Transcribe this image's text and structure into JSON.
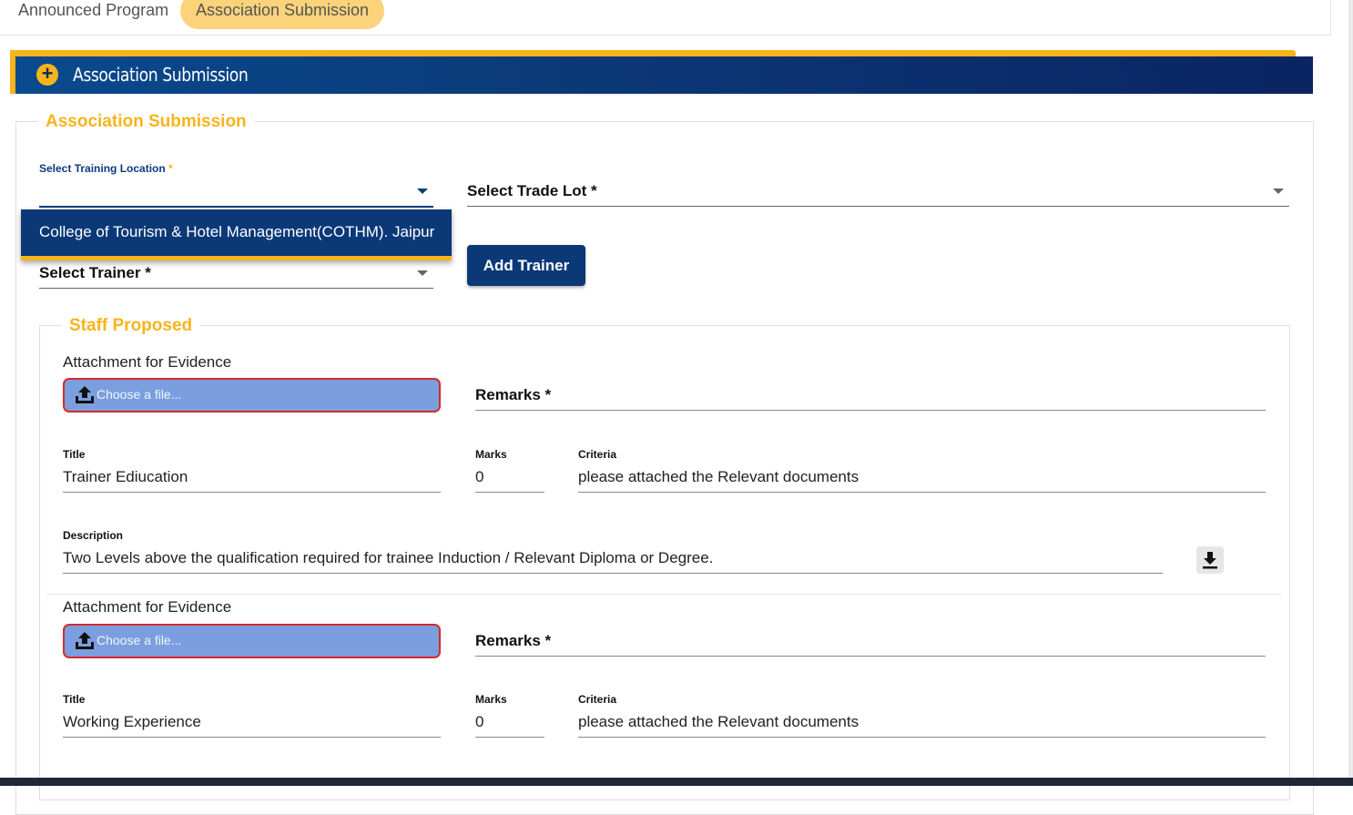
{
  "tabs": {
    "announced_label": "Announced Program",
    "association_label": "Association Submission"
  },
  "banner": {
    "title": "Association Submission"
  },
  "form": {
    "legend": "Association Submission",
    "training_location_label": "Select Training Location",
    "required_mark": "*",
    "trade_lot_label": "Select Trade Lot *",
    "trainer_label": "Select Trainer *",
    "add_trainer_label": "Add Trainer",
    "dropdown_option": "College of Tourism & Hotel Management(COTHM). Jaipur"
  },
  "staff": {
    "legend": "Staff Proposed",
    "items": [
      {
        "attachment_label": "Attachment for Evidence",
        "file_placeholder": "Choose a file...",
        "remarks_label": "Remarks *",
        "title_label": "Title",
        "title_value": "Trainer Ediucation",
        "marks_label": "Marks",
        "marks_value": "0",
        "criteria_label": "Criteria",
        "criteria_value": "please attached the Relevant documents",
        "description_label": "Description",
        "description_value": "Two Levels above the qualification required for trainee Induction / Relevant Diploma or Degree."
      },
      {
        "attachment_label": "Attachment for Evidence",
        "file_placeholder": "Choose a file...",
        "remarks_label": "Remarks *",
        "title_label": "Title",
        "title_value": "Working Experience",
        "marks_label": "Marks",
        "marks_value": "0",
        "criteria_label": "Criteria",
        "criteria_value": "please attached the Relevant documents"
      }
    ]
  },
  "icons": {
    "plus": "plus-icon",
    "upload": "upload-icon",
    "download": "download-icon",
    "caret": "caret-down-icon"
  },
  "colors": {
    "accent": "#f8b41b",
    "primary": "#0b3877",
    "file_button": "#7b9fde",
    "error_border": "#d52b2b"
  }
}
